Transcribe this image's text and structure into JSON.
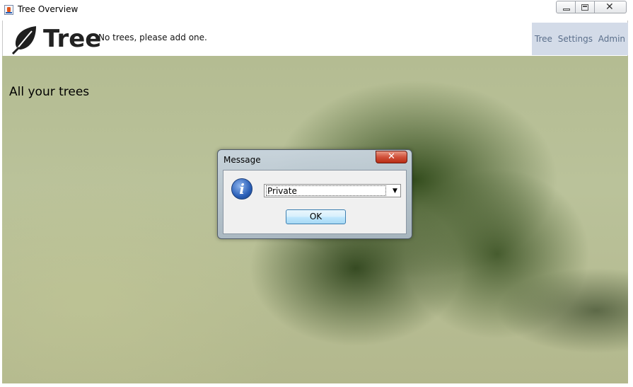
{
  "window": {
    "title": "Tree Overview"
  },
  "header": {
    "brand": "Tree",
    "status_message": "No trees, please add one.",
    "nav": [
      "Tree",
      "Settings",
      "Admin"
    ]
  },
  "main": {
    "heading": "All your trees"
  },
  "dialog": {
    "title": "Message",
    "close_glyph": "✕",
    "icon": "info-icon",
    "combo_value": "Private",
    "ok_label": "OK"
  },
  "colors": {
    "nav_background": "#d3dbe8",
    "nav_text": "#5b6f8b",
    "dialog_close": "#c8452c"
  }
}
